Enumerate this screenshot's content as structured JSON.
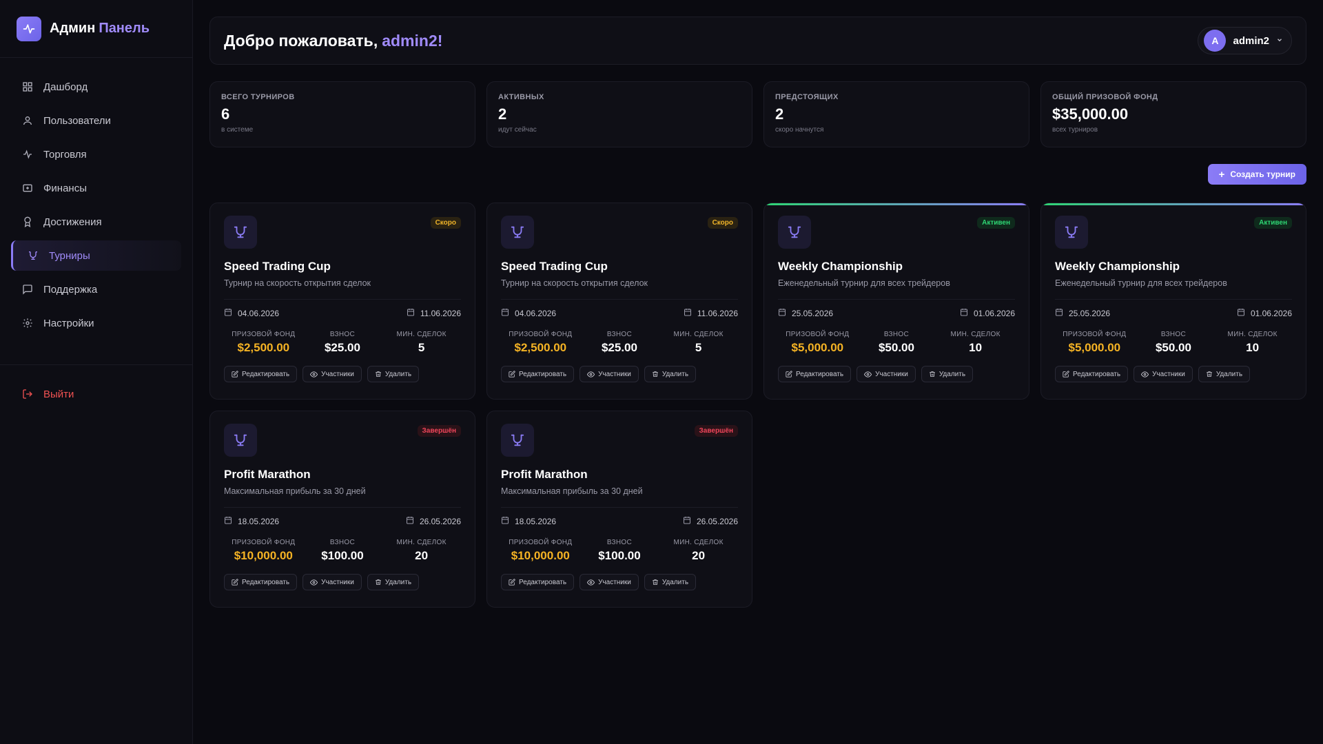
{
  "brand": {
    "title": "Админ",
    "accent": "Панель"
  },
  "nav": {
    "items": [
      {
        "label": "Дашборд",
        "icon": "grid-icon"
      },
      {
        "label": "Пользователи",
        "icon": "user-icon"
      },
      {
        "label": "Торговля",
        "icon": "activity-icon"
      },
      {
        "label": "Финансы",
        "icon": "wallet-icon"
      },
      {
        "label": "Достижения",
        "icon": "award-icon"
      },
      {
        "label": "Турниры",
        "icon": "trophy-icon",
        "active": true
      },
      {
        "label": "Поддержка",
        "icon": "message-icon"
      },
      {
        "label": "Настройки",
        "icon": "gear-icon"
      }
    ],
    "logout": "Выйти"
  },
  "header": {
    "welcome": "Добро пожаловать,",
    "username": "admin2!"
  },
  "user": {
    "avatar": "A",
    "name": "admin2"
  },
  "stats": [
    {
      "label": "ВСЕГО ТУРНИРОВ",
      "value": "6",
      "sub": "в системе"
    },
    {
      "label": "АКТИВНЫХ",
      "value": "2",
      "sub": "идут сейчас"
    },
    {
      "label": "ПРЕДСТОЯЩИХ",
      "value": "2",
      "sub": "скоро начнутся"
    },
    {
      "label": "ОБЩИЙ ПРИЗОВОЙ ФОНД",
      "value": "$35,000.00",
      "sub": "всех турниров"
    }
  ],
  "create_button": "Создать турнир",
  "labels": {
    "prize": "ПРИЗОВОЙ ФОНД",
    "fee": "ВЗНОС",
    "min_trades": "МИН. СДЕЛОК",
    "edit": "Редактировать",
    "participants": "Участники",
    "delete": "Удалить"
  },
  "colors": {
    "accent": "#8b7cf6",
    "prize": "#f5b324",
    "soon": "#f0b429",
    "active": "#2ed573",
    "done": "#f0455a"
  },
  "tournaments": [
    {
      "title": "Speed Trading Cup",
      "desc": "Турнир на скорость открытия сделок",
      "status": "Скоро",
      "status_type": "soon",
      "start": "04.06.2026",
      "end": "11.06.2026",
      "prize": "$2,500.00",
      "fee": "$25.00",
      "min_trades": "5"
    },
    {
      "title": "Speed Trading Cup",
      "desc": "Турнир на скорость открытия сделок",
      "status": "Скоро",
      "status_type": "soon",
      "start": "04.06.2026",
      "end": "11.06.2026",
      "prize": "$2,500.00",
      "fee": "$25.00",
      "min_trades": "5"
    },
    {
      "title": "Weekly Championship",
      "desc": "Еженедельный турнир для всех трейдеров",
      "status": "Активен",
      "status_type": "active",
      "start": "25.05.2026",
      "end": "01.06.2026",
      "prize": "$5,000.00",
      "fee": "$50.00",
      "min_trades": "10"
    },
    {
      "title": "Weekly Championship",
      "desc": "Еженедельный турнир для всех трейдеров",
      "status": "Активен",
      "status_type": "active",
      "start": "25.05.2026",
      "end": "01.06.2026",
      "prize": "$5,000.00",
      "fee": "$50.00",
      "min_trades": "10"
    },
    {
      "title": "Profit Marathon",
      "desc": "Максимальная прибыль за 30 дней",
      "status": "Завершён",
      "status_type": "done",
      "start": "18.05.2026",
      "end": "26.05.2026",
      "prize": "$10,000.00",
      "fee": "$100.00",
      "min_trades": "20"
    },
    {
      "title": "Profit Marathon",
      "desc": "Максимальная прибыль за 30 дней",
      "status": "Завершён",
      "status_type": "done",
      "start": "18.05.2026",
      "end": "26.05.2026",
      "prize": "$10,000.00",
      "fee": "$100.00",
      "min_trades": "20"
    }
  ]
}
